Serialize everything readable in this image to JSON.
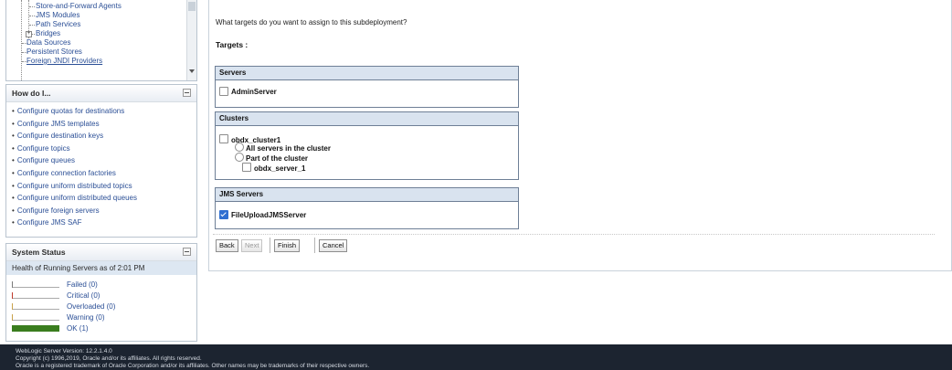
{
  "tree": {
    "items": [
      "Store-and-Forward Agents",
      "JMS Modules",
      "Path Services",
      "Bridges",
      "Data Sources",
      "Persistent Stores",
      "Foreign JNDI Providers"
    ]
  },
  "howdo": {
    "title": "How do I...",
    "links": [
      "Configure quotas for destinations",
      "Configure JMS templates",
      "Configure destination keys",
      "Configure topics",
      "Configure queues",
      "Configure connection factories",
      "Configure uniform distributed topics",
      "Configure uniform distributed queues",
      "Configure foreign servers",
      "Configure JMS SAF"
    ]
  },
  "system_status": {
    "title": "System Status",
    "health_label": "Health of Running Servers as of  2:01 PM",
    "rows": [
      {
        "label": "Failed (0)",
        "color": "#7a7a7a",
        "fill": 0
      },
      {
        "label": "Critical (0)",
        "color": "#c0392b",
        "fill": 0
      },
      {
        "label": "Overloaded (0)",
        "color": "#c9a14a",
        "fill": 0
      },
      {
        "label": "Warning (0)",
        "color": "#c9a14a",
        "fill": 0
      },
      {
        "label": "OK (1)",
        "color": "#3a7d1e",
        "fill": 1
      }
    ]
  },
  "main": {
    "question": "What targets do you want to assign to this subdeployment?",
    "targets_label": "Targets :",
    "servers": {
      "header": "Servers",
      "items": [
        {
          "label": "AdminServer",
          "checked": false
        }
      ]
    },
    "clusters": {
      "header": "Clusters",
      "cluster_name": "obdx_cluster1",
      "option_all": "All servers in the cluster",
      "option_part": "Part of the cluster",
      "server": "obdx_server_1"
    },
    "jms_servers": {
      "header": "JMS Servers",
      "items": [
        {
          "label": "FileUploadJMSServer",
          "checked": true
        }
      ]
    },
    "buttons": {
      "back": "Back",
      "next": "Next",
      "finish": "Finish",
      "cancel": "Cancel"
    }
  },
  "footer": {
    "version": "WebLogic Server Version: 12.2.1.4.0",
    "copyright": "Copyright (c) 1996,2019, Oracle and/or its affiliates. All rights reserved.",
    "trademark": "Oracle is a registered trademark of Oracle Corporation and/or its affiliates. Other names may be trademarks of their respective owners."
  }
}
